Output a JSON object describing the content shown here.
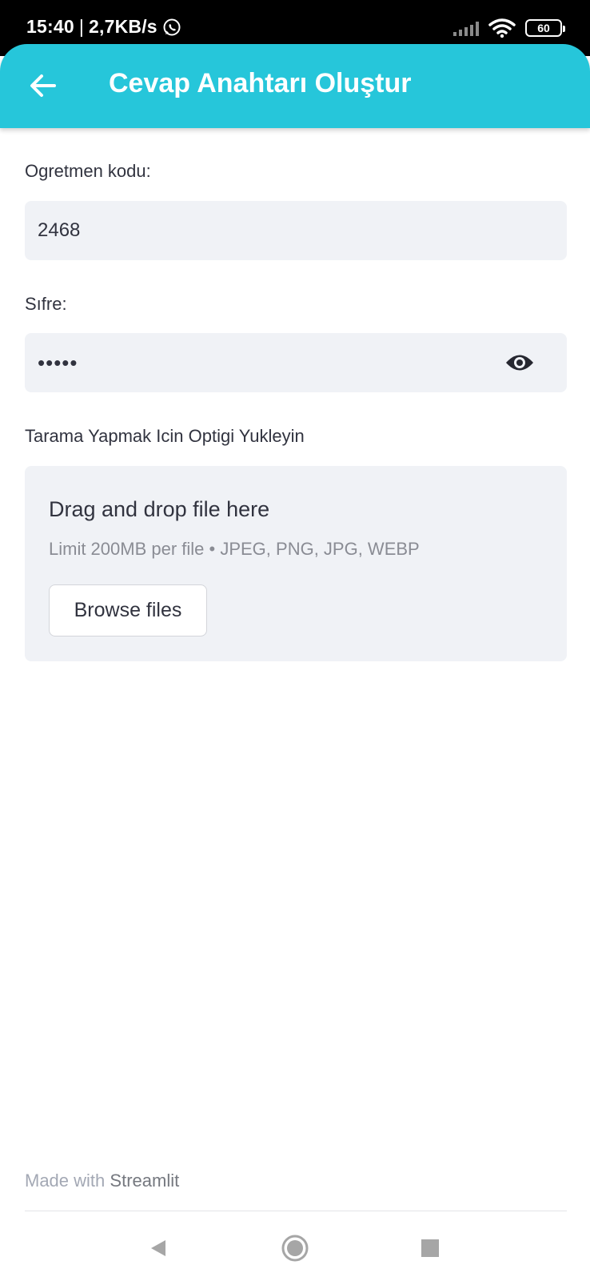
{
  "status_bar": {
    "time": "15:40",
    "separator": "|",
    "net_speed": "2,7KB/s",
    "battery": "60"
  },
  "header": {
    "title": "Cevap Anahtarı Oluştur",
    "back_icon": "arrow-left-icon",
    "color": "#26c6da"
  },
  "form": {
    "teacher_code": {
      "label": "Ogretmen kodu:",
      "value": "2468"
    },
    "password": {
      "label": "Sıfre:",
      "value": "•••••",
      "toggle_icon": "eye-icon"
    },
    "upload": {
      "label": "Tarama Yapmak Icin Optigi Yukleyin",
      "drop_title": "Drag and drop file here",
      "drop_subtitle": "Limit 200MB per file • JPEG, PNG, JPG, WEBP",
      "browse_label": "Browse files"
    }
  },
  "footer": {
    "made_with": "Made with",
    "brand": "Streamlit"
  },
  "nav_bar": {
    "back_icon": "triangle-back-icon",
    "home_icon": "circle-home-icon",
    "recents_icon": "square-recents-icon"
  }
}
